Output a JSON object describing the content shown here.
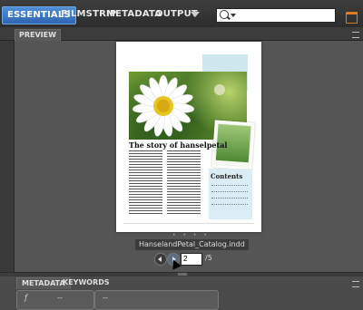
{
  "workspace": {
    "tabs": [
      {
        "label": "ESSENTIALS",
        "active": true
      },
      {
        "label": "FILMSTRIP"
      },
      {
        "label": "METADATA"
      },
      {
        "label": "OUTPUT"
      }
    ]
  },
  "search": {
    "icon": "search-icon",
    "value": ""
  },
  "preview_panel": {
    "tab_label": "PREVIEW"
  },
  "document": {
    "heading": "The story of hanselpetal",
    "contents_heading": "Contents",
    "page_dots": "• • • •"
  },
  "file": {
    "name": "HanselandPetal_Catalog.indd"
  },
  "pagination": {
    "current_page": "2",
    "total_label": "/5"
  },
  "bottom_panel": {
    "tabs": [
      {
        "label": "METADATA",
        "active": true
      },
      {
        "label": "KEYWORDS"
      }
    ],
    "fields": [
      {
        "icon": "f",
        "value": "--"
      },
      {
        "value": "--"
      }
    ]
  },
  "colors": {
    "accent_blue": "#3a78c8",
    "window_button": "#e07a1a"
  }
}
